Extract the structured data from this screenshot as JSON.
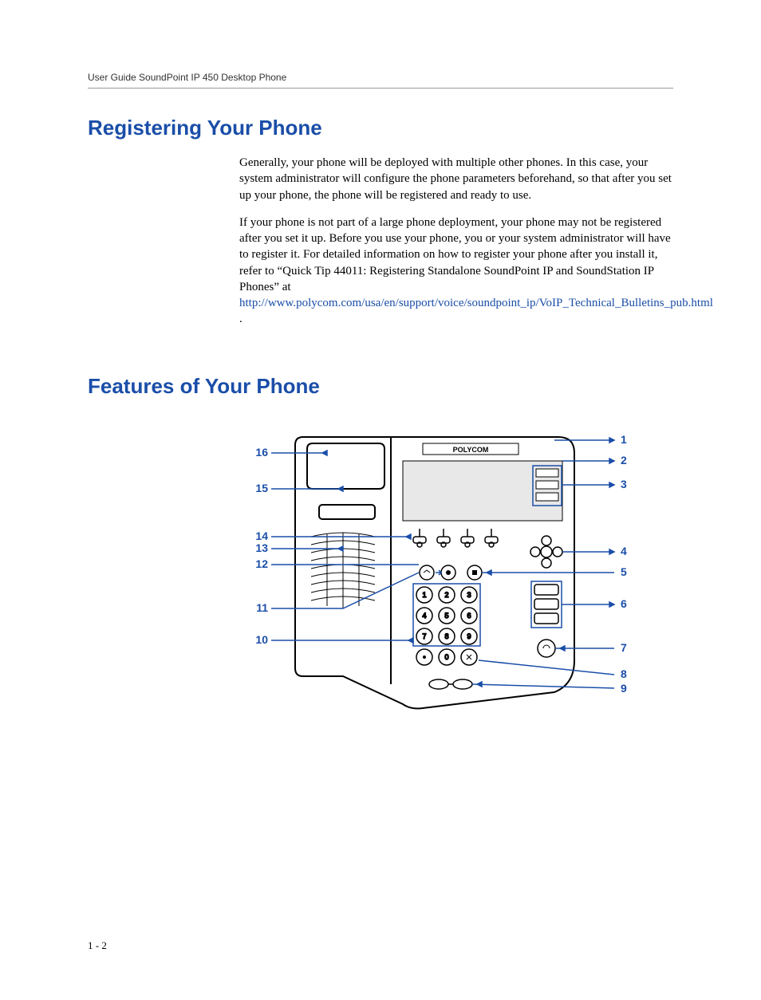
{
  "header": {
    "title": "User Guide SoundPoint IP 450 Desktop Phone"
  },
  "sections": {
    "registering": {
      "heading": "Registering Your Phone",
      "para1": "Generally, your phone will be deployed with multiple other phones. In this case, your system administrator will configure the phone parameters beforehand, so that after you set up your phone, the phone will be registered and ready to use.",
      "para2a": "If your phone is not part of a large phone deployment, your phone may not be registered after you set it up. Before you use your phone, you or your system administrator will have to register it. For detailed information on how to register your phone after you install it, refer to “Quick Tip 44011: Registering Standalone SoundPoint IP and SoundStation IP Phones” at ",
      "link_text": "http://www.polycom.com/usa/en/support/voice/soundpoint_ip/VoIP_Technical_Bulletins_pub.html",
      "para2b": " ."
    },
    "features": {
      "heading": "Features of Your Phone"
    }
  },
  "diagram": {
    "brand_label": "POLYCOM",
    "callouts_right": [
      "1",
      "2",
      "3",
      "4",
      "5",
      "6",
      "7",
      "8",
      "9"
    ],
    "callouts_left": [
      "16",
      "15",
      "14",
      "13",
      "12",
      "11",
      "10"
    ],
    "keypad": [
      [
        "1",
        "2",
        "3"
      ],
      [
        "4",
        "5",
        "6"
      ],
      [
        "7",
        "8",
        "9"
      ],
      [
        "*",
        "0",
        "#"
      ]
    ]
  },
  "footer": {
    "page_number": "1 - 2"
  }
}
